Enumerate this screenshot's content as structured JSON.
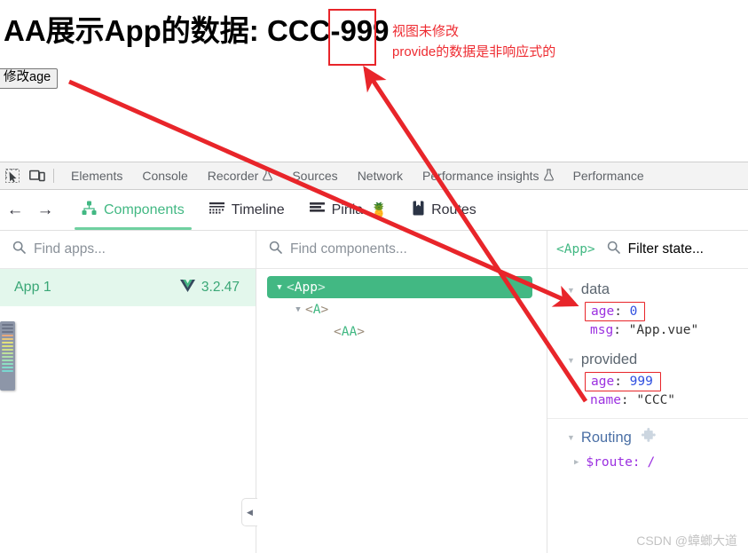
{
  "page": {
    "title": "AA展示App的数据: CCC-999",
    "button_label": "修改age",
    "annotation_line1": "视图未修改",
    "annotation_line2": "provide的数据是非响应式的"
  },
  "devtools": {
    "tabs": [
      {
        "label": "Elements",
        "flask": false
      },
      {
        "label": "Console",
        "flask": false
      },
      {
        "label": "Recorder",
        "flask": true
      },
      {
        "label": "Sources",
        "flask": false
      },
      {
        "label": "Network",
        "flask": false
      },
      {
        "label": "Performance insights",
        "flask": true
      },
      {
        "label": "Performance",
        "flask": false
      }
    ],
    "inspect_icon": "inspect-element-icon",
    "device_icon": "device-toolbar-icon"
  },
  "vue_tabs": {
    "back_arrow": "←",
    "forward_arrow": "→",
    "items": [
      {
        "label": "Components",
        "icon": "component-tree-icon",
        "active": true
      },
      {
        "label": "Timeline",
        "icon": "timeline-icon",
        "active": false
      },
      {
        "label": "Pinia",
        "icon": "pinia-icon",
        "emoji": "🍍",
        "active": false
      },
      {
        "label": "Routes",
        "icon": "routes-bookmark-icon",
        "active": false
      }
    ]
  },
  "apps_pane": {
    "search_placeholder": "Find apps...",
    "selected_app": {
      "name": "App 1",
      "version": "3.2.47",
      "logo": "vue-logo-icon"
    }
  },
  "tree_pane": {
    "search_placeholder": "Find components...",
    "nodes": [
      {
        "label": "App",
        "depth": 0,
        "expanded": true,
        "selected": true
      },
      {
        "label": "A",
        "depth": 1,
        "expanded": true,
        "selected": false
      },
      {
        "label": "AA",
        "depth": 2,
        "expanded": false,
        "selected": false
      }
    ]
  },
  "state_pane": {
    "component_tag": "<App>",
    "filter_placeholder": "Filter state...",
    "groups": [
      {
        "name": "data",
        "expanded": true,
        "entries": [
          {
            "key": "age",
            "value": "0",
            "type": "number",
            "highlighted": true
          },
          {
            "key": "msg",
            "value": "\"App.vue\"",
            "type": "string",
            "highlighted": false
          }
        ]
      },
      {
        "name": "provided",
        "expanded": true,
        "entries": [
          {
            "key": "age",
            "value": "999",
            "type": "number",
            "highlighted": true
          },
          {
            "key": "name",
            "value": "\"CCC\"",
            "type": "string",
            "highlighted": false
          }
        ]
      }
    ],
    "routing": {
      "name": "Routing",
      "icon": "puzzle-piece-icon",
      "expanded": true,
      "route_key": "$route:",
      "route_value": "/"
    }
  },
  "watermark": "CSDN @蟑螂大道",
  "colors": {
    "vue_green": "#42b883",
    "annotation_red": "#ee2b31",
    "highlight_box": "#e8252a",
    "app_row_bg": "#e3f7ec"
  }
}
